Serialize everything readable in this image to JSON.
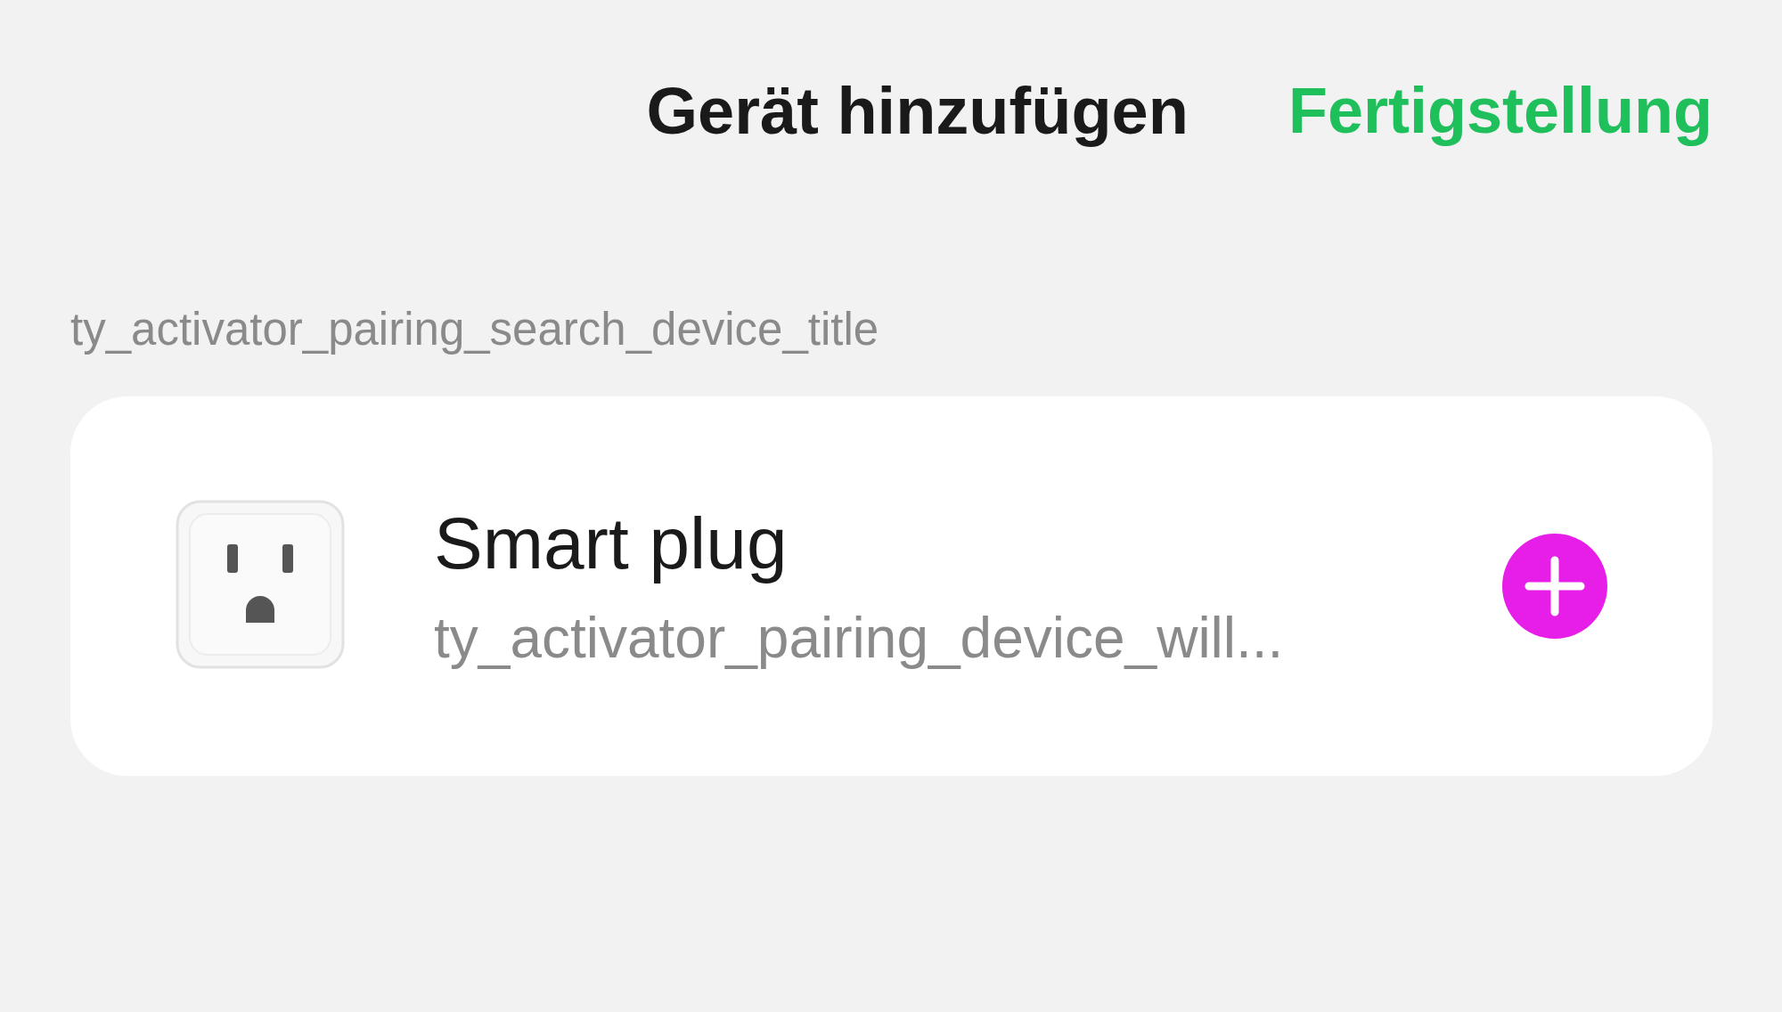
{
  "header": {
    "title": "Gerät hinzufügen",
    "action": "Fertigstellung"
  },
  "section_title": "ty_activator_pairing_search_device_title",
  "devices": [
    {
      "name": "Smart plug",
      "description": "ty_activator_pairing_device_will...",
      "kind": "plug"
    }
  ]
}
